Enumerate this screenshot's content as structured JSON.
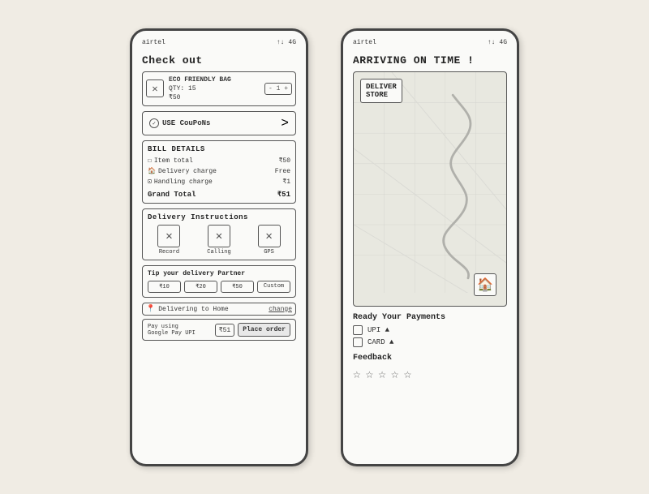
{
  "left_phone": {
    "status_bar": {
      "carrier": "airtel",
      "icons": "↑↓ 4G"
    },
    "title": "Check out",
    "cart_item": {
      "name": "ECO FRIENDLY BAG",
      "qty": "QTY: 15",
      "price": "₹50"
    },
    "coupon": {
      "label": "USE CouPoNs",
      "arrow": ">"
    },
    "bill": {
      "title": "BILL DETAILS",
      "item_total_label": "Item total",
      "item_total_value": "₹50",
      "delivery_label": "Delivery charge",
      "delivery_value": "Free",
      "handling_label": "Handling charge",
      "handling_value": "₹1",
      "grand_total_label": "Grand Total",
      "grand_total_value": "₹51"
    },
    "delivery_instructions": {
      "title": "Delivery Instructions",
      "options": [
        "Record",
        "Calling",
        "GPS"
      ]
    },
    "tip": {
      "title": "Tip your delivery Partner",
      "options": [
        "₹10",
        "₹20",
        "₹50",
        "Custom"
      ]
    },
    "address": {
      "label": "Delivering to Home",
      "action": "change"
    },
    "bottom_bar": {
      "pay_using": "Pay using",
      "pay_method": "Google Pay UPI",
      "amount": "₹51",
      "button": "Place order"
    }
  },
  "right_phone": {
    "status_bar": {
      "carrier": "airtel",
      "icons": "↑↓ 4G"
    },
    "title": "ARRIVING ON TIME !",
    "map": {
      "store_label": "DELIVER\nSTORE"
    },
    "payment": {
      "title": "Ready Your Payments",
      "options": [
        {
          "label": "UPI ▲"
        },
        {
          "label": "CARD ▲"
        }
      ]
    },
    "feedback": {
      "title": "Feedback",
      "stars": [
        "★",
        "★",
        "★",
        "★",
        "★"
      ]
    }
  }
}
